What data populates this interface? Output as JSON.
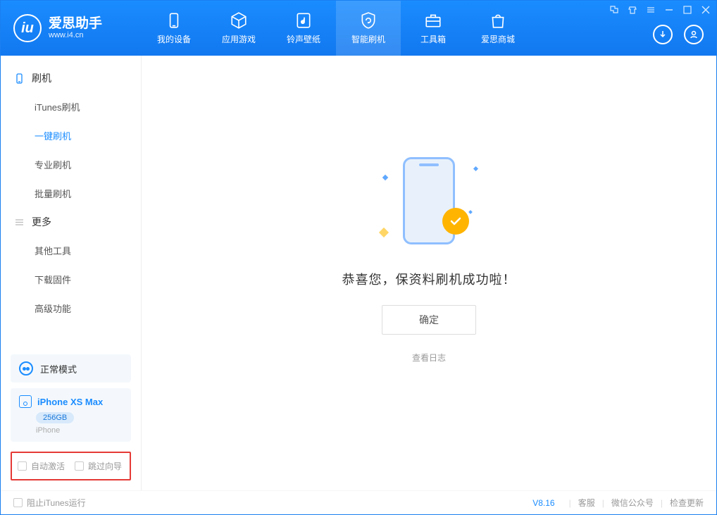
{
  "app": {
    "name": "爱思助手",
    "url": "www.i4.cn"
  },
  "nav": {
    "items": [
      {
        "label": "我的设备"
      },
      {
        "label": "应用游戏"
      },
      {
        "label": "铃声壁纸"
      },
      {
        "label": "智能刷机"
      },
      {
        "label": "工具箱"
      },
      {
        "label": "爱思商城"
      }
    ]
  },
  "sidebar": {
    "section1_title": "刷机",
    "items1": [
      {
        "label": "iTunes刷机"
      },
      {
        "label": "一键刷机"
      },
      {
        "label": "专业刷机"
      },
      {
        "label": "批量刷机"
      }
    ],
    "section2_title": "更多",
    "items2": [
      {
        "label": "其他工具"
      },
      {
        "label": "下载固件"
      },
      {
        "label": "高级功能"
      }
    ],
    "mode_label": "正常模式",
    "device_name": "iPhone XS Max",
    "device_storage": "256GB",
    "device_type": "iPhone",
    "checkbox1": "自动激活",
    "checkbox2": "跳过向导"
  },
  "main": {
    "success_text": "恭喜您，保资料刷机成功啦！",
    "ok_button": "确定",
    "log_link": "查看日志"
  },
  "footer": {
    "block_itunes": "阻止iTunes运行",
    "version": "V8.16",
    "link_service": "客服",
    "link_wechat": "微信公众号",
    "link_update": "检查更新"
  }
}
